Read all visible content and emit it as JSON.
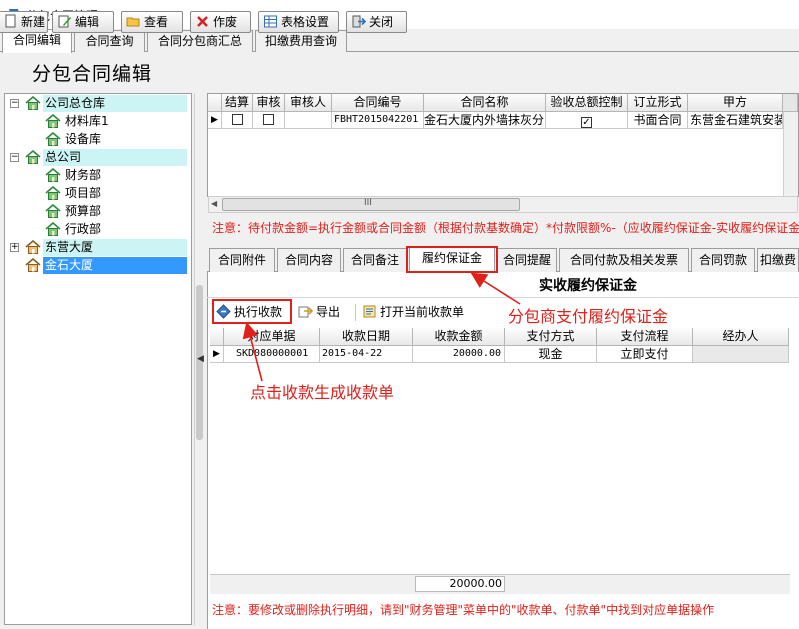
{
  "window": {
    "title": "分包合同管理"
  },
  "main_tabs": [
    {
      "label": "合同编辑",
      "active": true
    },
    {
      "label": "合同查询",
      "active": false
    },
    {
      "label": "合同分包商汇总",
      "active": false
    },
    {
      "label": "扣缴费用查询",
      "active": false
    }
  ],
  "toolbar": {
    "ghost_title": "分包合同编辑",
    "buttons": [
      {
        "label": "新建",
        "icon": "new-doc-icon"
      },
      {
        "label": "编辑",
        "icon": "edit-icon"
      },
      {
        "label": "查看",
        "icon": "folder-open-icon"
      },
      {
        "label": "作废",
        "icon": "red-x-icon"
      },
      {
        "label": "表格设置",
        "icon": "table-settings-icon"
      },
      {
        "label": "关闭",
        "icon": "exit-icon"
      }
    ]
  },
  "tree": {
    "nodes": [
      {
        "label": "公司总仓库",
        "level": 0,
        "expander": "−",
        "highlight": true
      },
      {
        "label": "材料库1",
        "level": 1
      },
      {
        "label": "设备库",
        "level": 1
      },
      {
        "label": "总公司",
        "level": 0,
        "expander": "−",
        "highlight": true
      },
      {
        "label": "财务部",
        "level": 1
      },
      {
        "label": "项目部",
        "level": 1
      },
      {
        "label": "预算部",
        "level": 1
      },
      {
        "label": "行政部",
        "level": 1
      },
      {
        "label": "东营大厦",
        "level": 0,
        "expander": "+",
        "highlight": true
      },
      {
        "label": "金石大厦",
        "level": 0,
        "selected": true
      }
    ]
  },
  "contract_grid": {
    "columns": [
      "结算",
      "审核",
      "审核人",
      "合同编号",
      "合同名称",
      "验收总额控制",
      "订立形式",
      "甲方"
    ],
    "rows": [
      {
        "marker": "▶",
        "settled": false,
        "audited": false,
        "auditor": "",
        "code": "FBHT2015042201",
        "name": "金石大厦内外墙抹灰分",
        "acceptance_control": true,
        "form": "书面合同",
        "party_a": "东营金石建筑安装"
      }
    ],
    "scroll_grip": "III"
  },
  "notice_formula": "注意：待付款金额=执行金额或合同金额（根据付款基数确定）*付款限额%-（应收履约保证金-实收履约保证金）-已付",
  "lower_tabs": [
    {
      "label": "合同附件",
      "active": false
    },
    {
      "label": "合同内容",
      "active": false
    },
    {
      "label": "合同备注",
      "active": false
    },
    {
      "label": "履约保证金",
      "active": true
    },
    {
      "label": "合同提醒",
      "active": false
    },
    {
      "label": "合同付款及相关发票",
      "active": false
    },
    {
      "label": "合同罚款",
      "active": false
    },
    {
      "label": "扣缴费",
      "active": false
    }
  ],
  "deposit": {
    "section_title": "实收履约保证金",
    "actions": [
      {
        "label": "执行收款",
        "icon": "execute-icon"
      },
      {
        "label": "导出",
        "icon": "export-icon"
      },
      {
        "label": "打开当前收款单",
        "icon": "open-receipt-icon"
      }
    ],
    "columns": [
      "对应单据",
      "收款日期",
      "收款金额",
      "支付方式",
      "支付流程",
      "经办人"
    ],
    "rows": [
      {
        "marker": "▶",
        "doc": "SKD080000001",
        "date": "2015-04-22",
        "amount": "20000.00",
        "method": "现金",
        "flow": "立即支付",
        "handler": ""
      }
    ],
    "total": "20000.00"
  },
  "notice_edit": "注意：要修改或删除执行明细，请到\"财务管理\"菜单中的\"收款单、付款单\"中找到对应单据操作",
  "annotations": {
    "deposit_note": "分包商支付履约保证金",
    "receipt_note": "点击收款生成收款单",
    "color": "#e0201a"
  }
}
